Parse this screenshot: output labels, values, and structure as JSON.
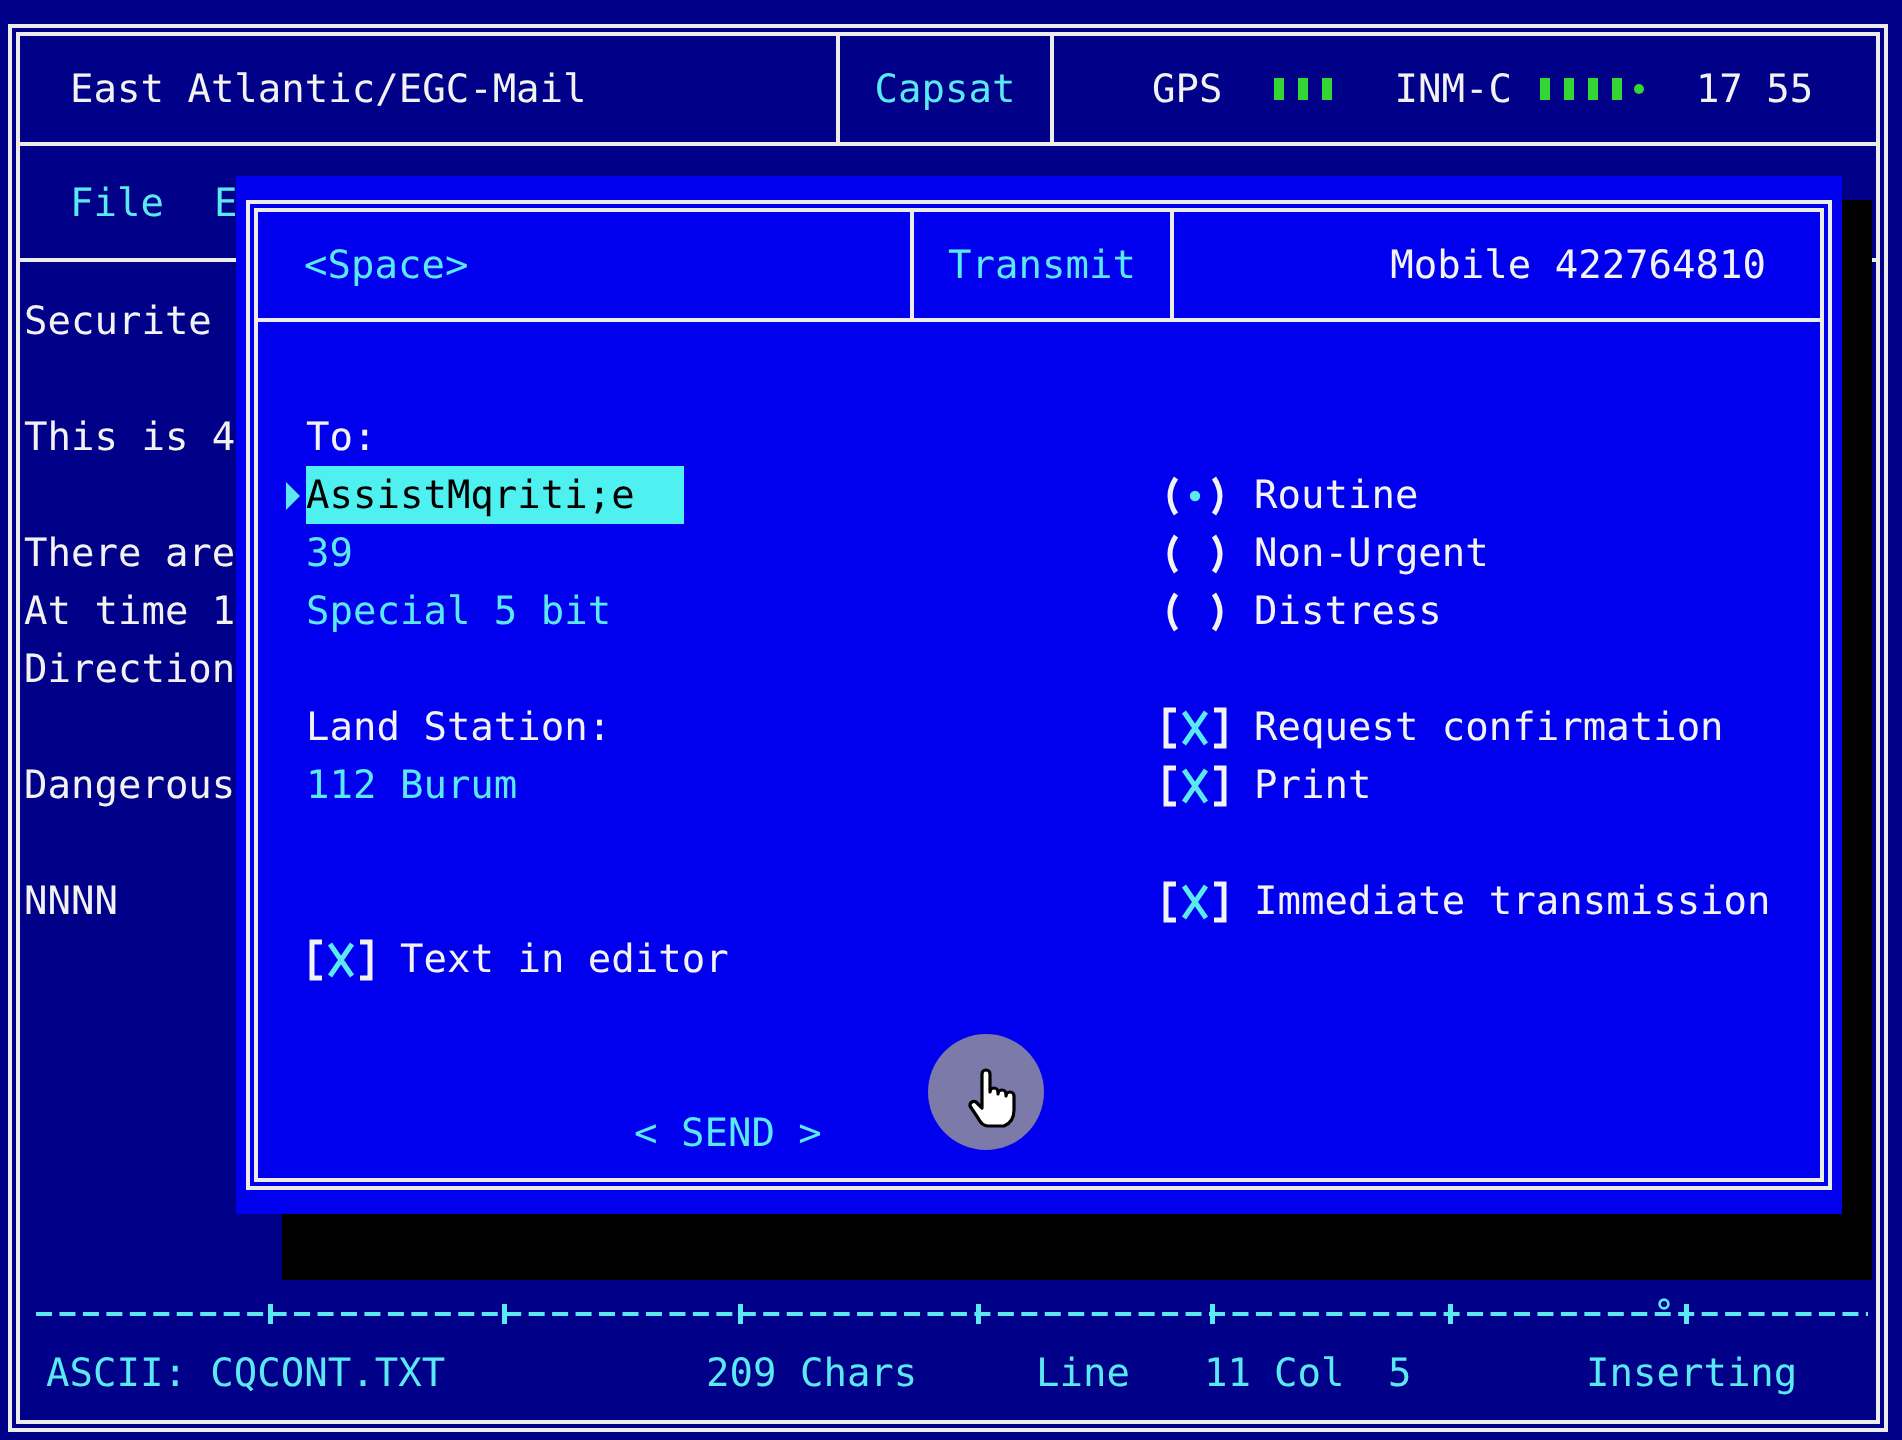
{
  "window": {
    "title": "East Atlantic/EGC-Mail",
    "app": "Capsat",
    "gps": {
      "label": "GPS"
    },
    "network": {
      "label": "INM-C"
    },
    "time": "17 55"
  },
  "menu": [
    {
      "label": "File"
    },
    {
      "label": "E"
    }
  ],
  "editor": {
    "paragraphs": [
      [
        "Securite"
      ],
      [
        "This is 4"
      ],
      [
        "There are",
        "At time 1",
        "Direction"
      ],
      [
        "Dangerous"
      ],
      [
        "NNNN"
      ]
    ]
  },
  "dialog": {
    "key_hint": "<Space>",
    "title": "Transmit",
    "mobile": "Mobile 422764810",
    "to": {
      "label": "To:",
      "entries": [
        {
          "value": "AssistMqriti;e",
          "selected": true
        },
        {
          "value": "39",
          "selected": false
        },
        {
          "value": "Special 5 bit",
          "selected": false
        }
      ]
    },
    "land_station": {
      "label": "Land Station:",
      "value": "112 Burum"
    },
    "text_in_editor": {
      "label": "Text in editor",
      "checked": true
    },
    "priority": [
      {
        "label": "Routine",
        "selected": true
      },
      {
        "label": "Non-Urgent",
        "selected": false
      },
      {
        "label": "Distress",
        "selected": false
      }
    ],
    "options": [
      {
        "label": "Request confirmation",
        "checked": true
      },
      {
        "label": "Print",
        "checked": true
      }
    ],
    "immediate_transmission": {
      "label": "Immediate transmission",
      "checked": true
    },
    "send_button": {
      "label": "< SEND >"
    }
  },
  "status_bar": {
    "file": "ASCII: CQCONT.TXT",
    "chars": "209 Chars",
    "line_label": "Line",
    "line": "11",
    "col_label": "Col",
    "col": "5",
    "mode": "Inserting"
  }
}
